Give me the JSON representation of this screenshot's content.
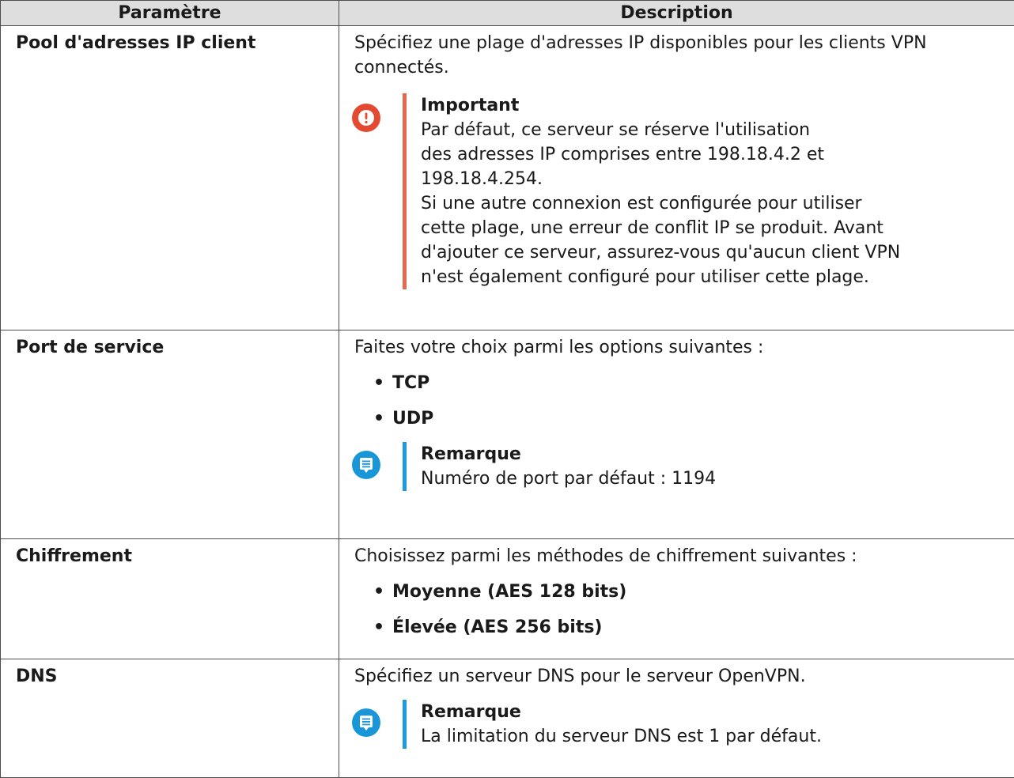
{
  "table": {
    "headers": {
      "param": "Paramètre",
      "desc": "Description"
    },
    "pool": {
      "label": "Pool d'adresses IP client",
      "desc_line1": "Spécifiez une plage d'adresses IP disponibles pour les clients VPN",
      "desc_line2": "connectés.",
      "callout": {
        "icon": "exclamation-icon",
        "color": "#e44a31",
        "title": "Important",
        "lines": [
          "Par défaut, ce serveur se réserve l'utilisation",
          "des adresses IP comprises entre 198.18.4.2 et",
          "198.18.4.254.",
          "Si une autre connexion est configurée pour utiliser",
          "cette plage, une erreur de conflit IP se produit. Avant",
          "d'ajouter ce serveur, assurez-vous qu'aucun client VPN",
          "n'est également configuré pour utiliser cette plage."
        ]
      }
    },
    "port": {
      "label": "Port de service",
      "desc": "Faites votre choix parmi les options suivantes :",
      "options": [
        "TCP",
        "UDP"
      ],
      "callout": {
        "icon": "note-icon",
        "color": "#1996d8",
        "title": "Remarque",
        "text": "Numéro de port par défaut : 1194"
      }
    },
    "encryption": {
      "label": "Chiffrement",
      "desc": "Choisissez parmi les méthodes de chiffrement suivantes :",
      "options": [
        "Moyenne (AES 128 bits)",
        "Élevée (AES 256 bits)"
      ]
    },
    "dns": {
      "label": "DNS",
      "desc": "Spécifiez un serveur DNS pour le serveur OpenVPN.",
      "callout": {
        "icon": "note-icon",
        "color": "#1996d8",
        "title": "Remarque",
        "text": "La limitation du serveur DNS est 1 par défaut."
      }
    },
    "bullet": "•"
  }
}
